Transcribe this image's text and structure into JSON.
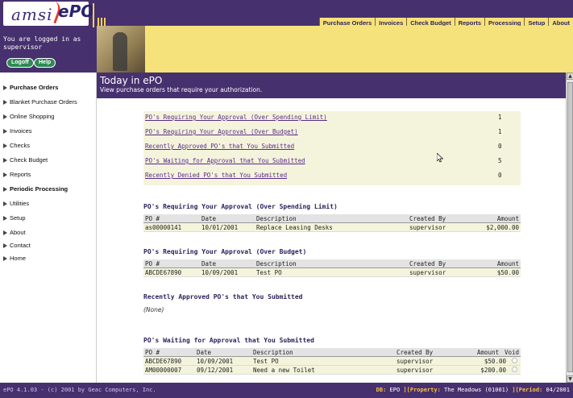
{
  "header": {
    "logo_amsi": "amsi",
    "logo_epo": "ePO",
    "nav": [
      "Purchase Orders",
      "Invoices",
      "Check Budget",
      "Reports",
      "Processing",
      "Setup",
      "About"
    ]
  },
  "user": {
    "logged_in_text": "You are logged in as supervisor",
    "logoff_label": "Logoff",
    "help_label": "Help"
  },
  "sidebar": {
    "items": [
      "Purchase Orders",
      "Blanket Purchase Orders",
      "Online Shopping",
      "Invoices",
      "Checks",
      "Check Budget",
      "Reports",
      "Periodic Processing",
      "Utilities",
      "Setup",
      "About",
      "Contact",
      "Home"
    ]
  },
  "page": {
    "title": "Today in ePO",
    "subtitle": "View purchase orders that require your authorization."
  },
  "summary": [
    {
      "label": "PO's Requiring Your Approval (Over Spending Limit)",
      "count": "1"
    },
    {
      "label": "PO's Requiring Your Approval (Over Budget)",
      "count": "1"
    },
    {
      "label": "Recently Approved PO's that You Submitted",
      "count": "0"
    },
    {
      "label": "PO's Waiting for Approval that You Submitted",
      "count": "5"
    },
    {
      "label": "Recently Denied PO's that You Submitted",
      "count": "0"
    }
  ],
  "sections": {
    "over_limit": {
      "title": "PO's Requiring Your Approval (Over Spending Limit)",
      "columns": [
        "PO #",
        "Date",
        "Description",
        "Created By",
        "Amount"
      ],
      "rows": [
        [
          "as00000141",
          "10/01/2001",
          "Replace Leasing Desks",
          "supervisor",
          "$2,000.00"
        ]
      ]
    },
    "over_budget": {
      "title": "PO's Requiring Your Approval (Over Budget)",
      "columns": [
        "PO #",
        "Date",
        "Description",
        "Created By",
        "Amount"
      ],
      "rows": [
        [
          "ABCDE67890",
          "10/09/2001",
          "Test PO",
          "supervisor",
          "$50.00"
        ]
      ]
    },
    "recently_approved": {
      "title": "Recently Approved PO's that You Submitted",
      "none_text": "(None)"
    },
    "waiting": {
      "title": "PO's Waiting for Approval that You Submitted",
      "columns": [
        "PO #",
        "Date",
        "Description",
        "Created By",
        "Amount",
        "Void"
      ],
      "rows": [
        [
          "ABCDE67890",
          "10/09/2001",
          "Test PO",
          "supervisor",
          "$50.00"
        ],
        [
          "AM00000007",
          "09/12/2001",
          "Need a new Toilet",
          "supervisor",
          "$200.00"
        ]
      ]
    }
  },
  "footer": {
    "copyright": "ePO 4.1.03 - (c) 2001 by Geac Computers, Inc.",
    "db_label": "DB:",
    "db_value": "EPO",
    "property_label": "Property:",
    "property_value": "The Meadows (01001)",
    "period_label": "Period:",
    "period_value": "04/2001"
  },
  "colors": {
    "brand_purple": "#47306e",
    "accent_yellow": "#f6e27b",
    "link_purple": "#5a2a8a",
    "button_green": "#2e8a55"
  }
}
